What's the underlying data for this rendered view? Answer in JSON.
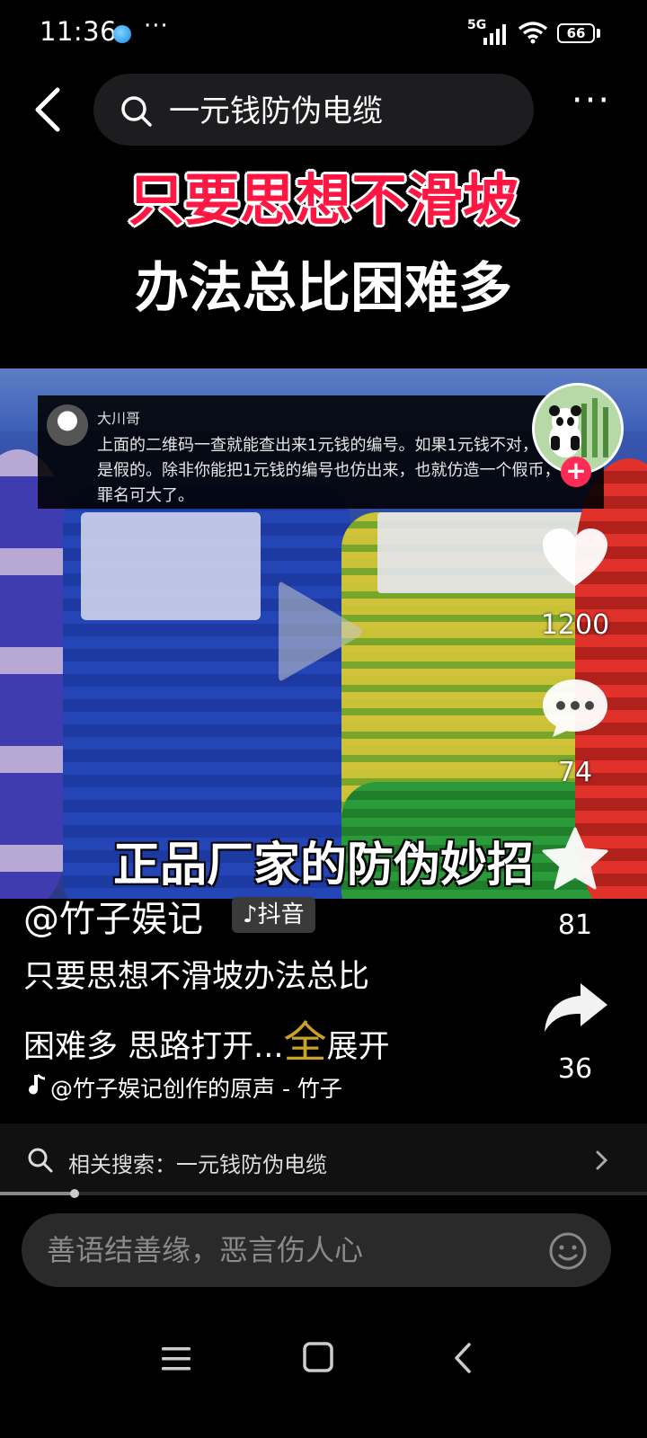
{
  "status_bar": {
    "time": "11:36",
    "more": "···",
    "network": "5G",
    "battery": "66"
  },
  "top_nav": {
    "search_query": "一元钱防伪电缆",
    "more": "···"
  },
  "video": {
    "headline_1": "只要思想不滑坡",
    "headline_2": "办法总比困难多",
    "comment_overlay": {
      "user": "大川哥",
      "text": "上面的二维码一查就能查出来1元钱的编号。如果1元钱不对，说明就是假的。除非你能把1元钱的编号也仿出来，也就仿造一个假币，那罪名可大了。"
    },
    "caption": "正品厂家的防伪妙招",
    "progress": 0.115
  },
  "right_rail": {
    "like_count": "1200",
    "comment_count": "74",
    "favorite_count": "81",
    "share_count": "36",
    "follow": "+"
  },
  "info": {
    "author": "@竹子娱记",
    "badge": "抖音",
    "desc_line_1": "只要思想不滑坡办法总比",
    "desc_line_2_text": "困难多 思路打开",
    "desc_ellipsis": "...",
    "expand_full": "全",
    "expand_link": "展开",
    "music": "@竹子娱记创作的原声 - 竹子"
  },
  "related": {
    "text": "相关搜索：一元钱防伪电缆"
  },
  "comment_input": {
    "placeholder": "善语结善缘，恶言伤人心"
  },
  "colors": {
    "headline_red": "#ff1744",
    "follow_red": "#fe2c55",
    "expand_gold": "#c9a227"
  }
}
